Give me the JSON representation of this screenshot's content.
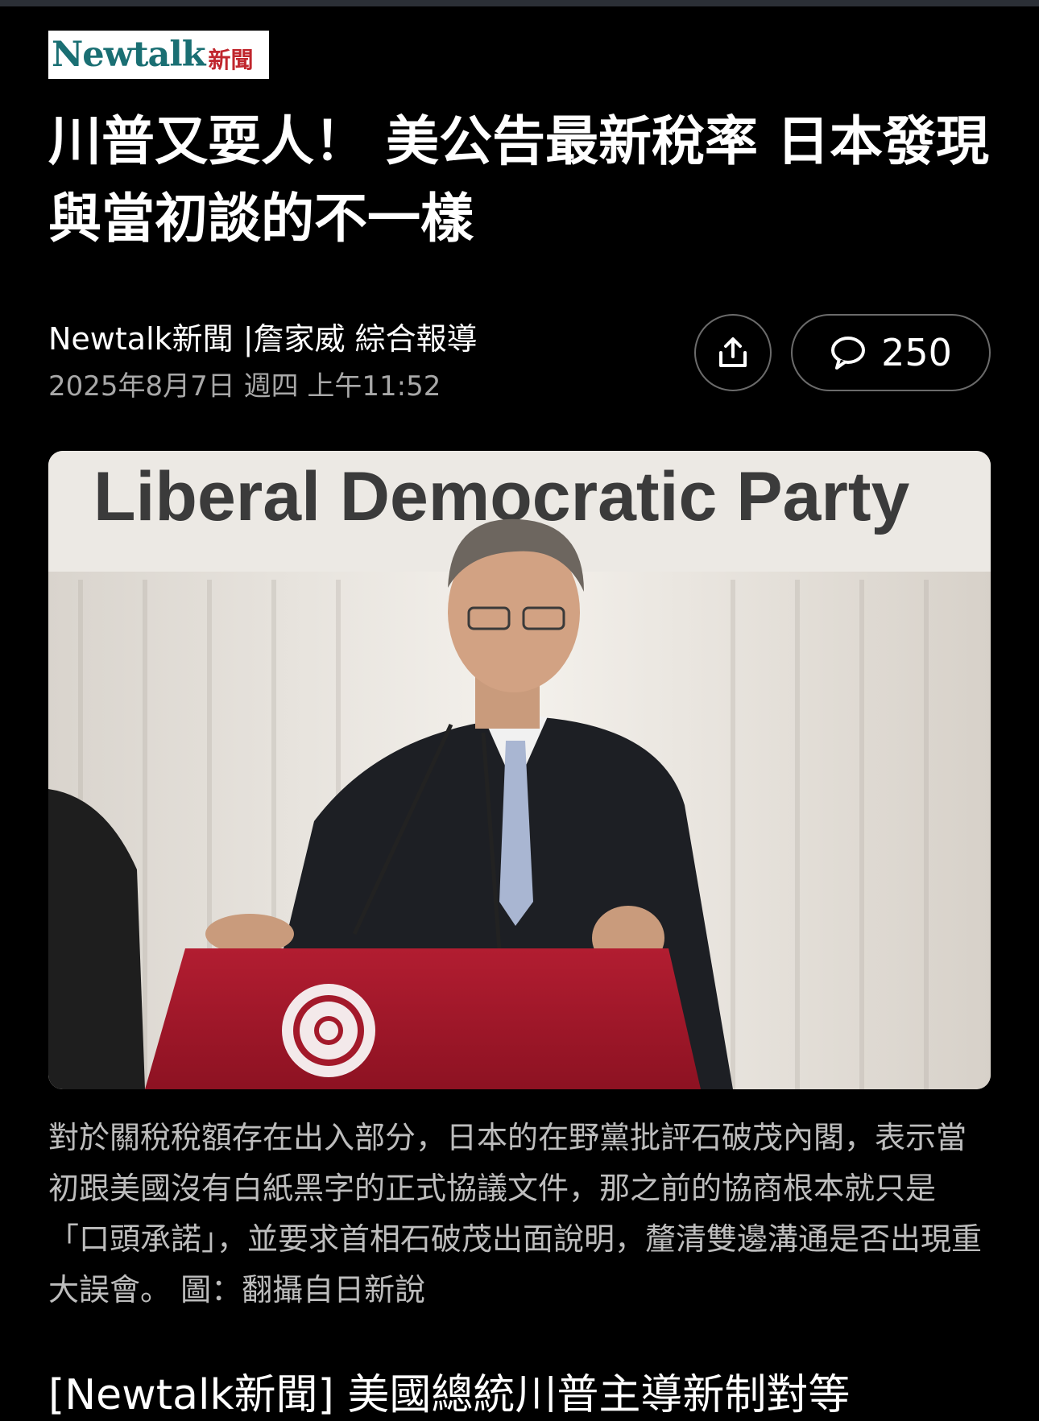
{
  "status_bar": {},
  "brand": {
    "logo_word": "Newtalk",
    "logo_cjk": "新聞"
  },
  "article": {
    "headline": "川普又耍人！ 美公告最新稅率 日本發現與當初談的不一樣",
    "byline": "Newtalk新聞 |詹家威 綜合報導",
    "date": "2025年8月7日 週四 上午11:52",
    "comment_count": "250",
    "share_icon": "share-icon",
    "comment_icon": "comment-bubble-icon",
    "image": {
      "banner_text": "Liberal Democratic Party"
    },
    "caption": "對於關稅稅額存在出入部分，日本的在野黨批評石破茂內閣，表示當初跟美國沒有白紙黑字的正式協議文件，那之前的協商根本就只是「口頭承諾」，並要求首相石破茂出面說明，釐清雙邊溝通是否出現重大誤會。 圖：翻攝自日新說",
    "lead_paragraph": "[Newtalk新聞] 美國總統川普主導新制對等"
  },
  "colors": {
    "background": "#000000",
    "logo_teal": "#1a6f73",
    "logo_red": "#c0262d",
    "podium_red": "#a3192a",
    "meta_gray": "#a8a8a8",
    "caption_gray": "#bdbdbd"
  }
}
